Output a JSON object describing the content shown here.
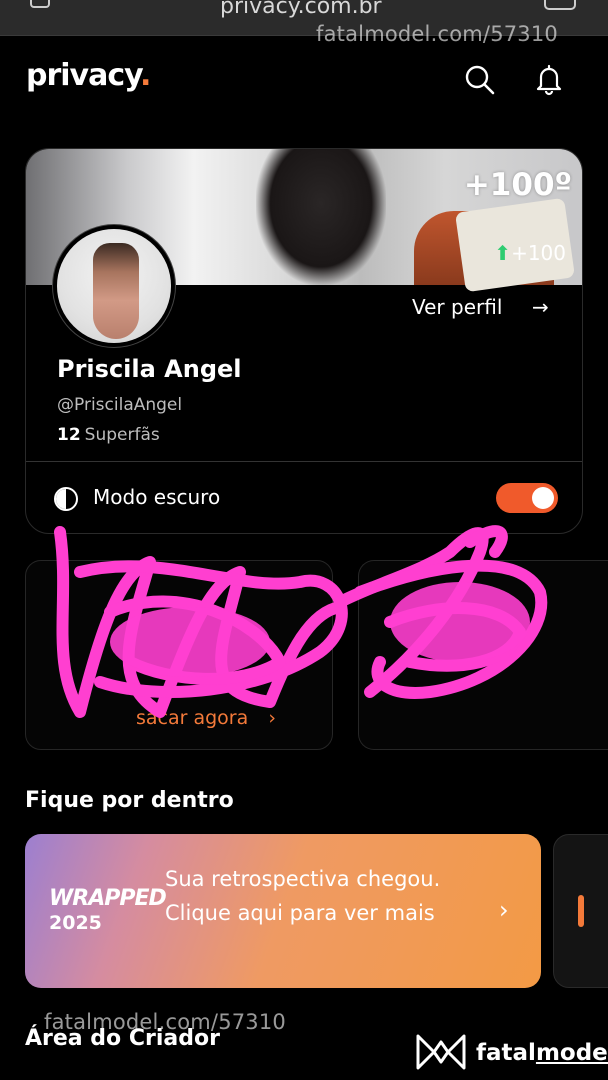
{
  "browser": {
    "url": "privacy.com.br"
  },
  "watermark": {
    "top_text": "fatalmodel.com/57310",
    "bottom_text": "fatalmodel.com/57310"
  },
  "header": {
    "logo_main": "privacy",
    "logo_dot": "."
  },
  "profile": {
    "cover_count_big": "+100º",
    "cover_count_small": "+100",
    "view_profile_label": "Ver perfil",
    "name": "Priscila Angel",
    "handle": "@PriscilaAngel",
    "superfans_count": "12",
    "superfans_label": "Superfãs",
    "dark_mode_label": "Modo escuro",
    "dark_mode_on": true
  },
  "cards": {
    "left_link": "sacar agora"
  },
  "sections": {
    "stay_informed": "Fique por dentro",
    "creator_area": "Área do Criador"
  },
  "banner": {
    "wrapped": "WRAPPED",
    "year": "2025",
    "text": "Sua retrospectiva chegou. Clique aqui para ver mais"
  },
  "brand": {
    "fatal": "fatal",
    "model": "model"
  },
  "colors": {
    "accent": "#f47a3a",
    "toggle": "#f05a2b",
    "scribble": "#ff3fd0"
  }
}
